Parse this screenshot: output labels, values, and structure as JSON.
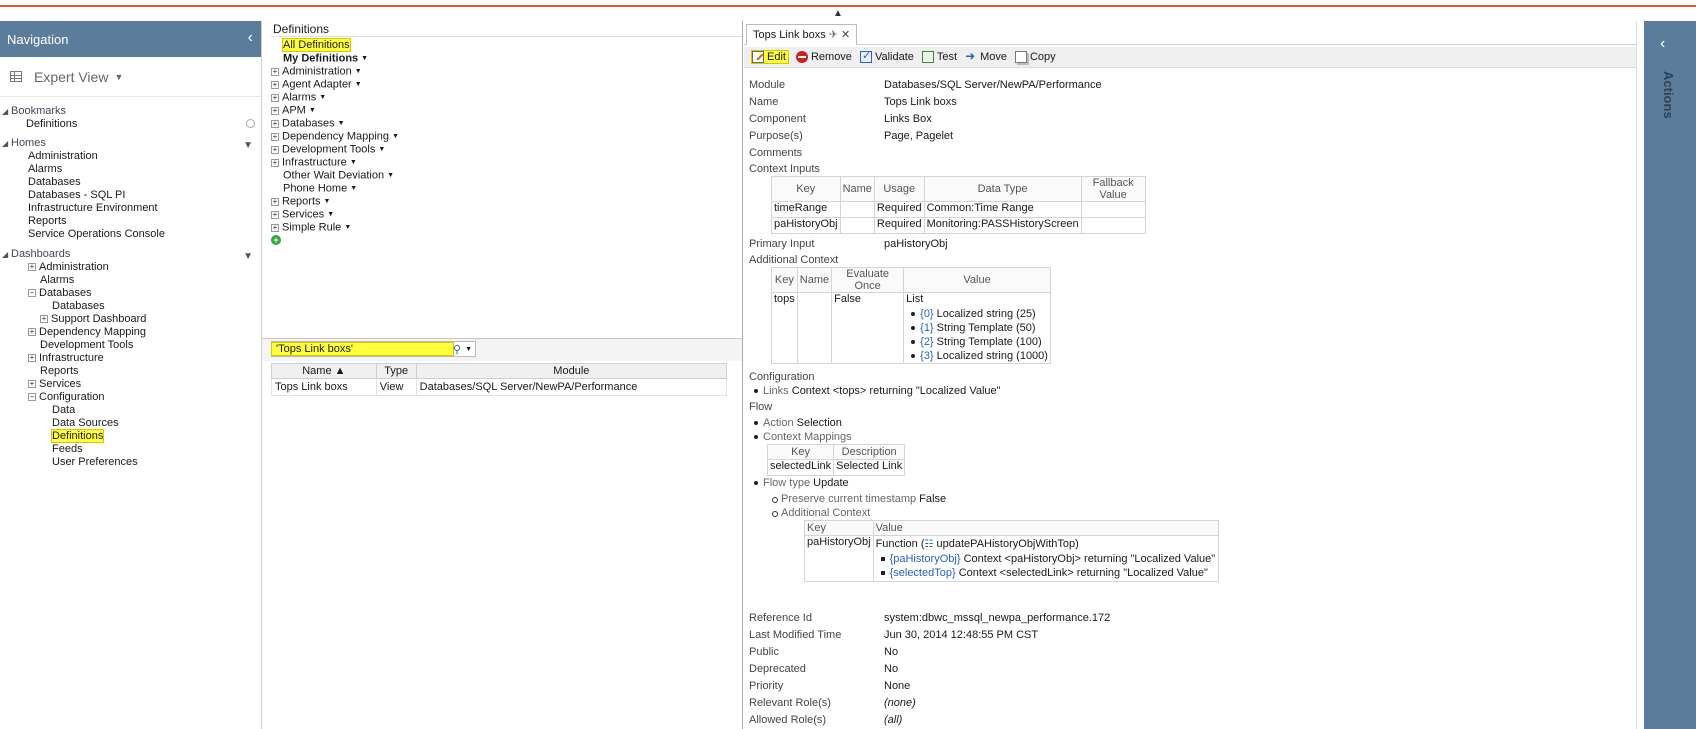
{
  "nav": {
    "title": "Navigation",
    "view": "Expert View",
    "bookmarks": {
      "title": "Bookmarks",
      "items": [
        "Definitions"
      ]
    },
    "homes": {
      "title": "Homes",
      "items": [
        "Administration",
        "Alarms",
        "Databases",
        "Databases - SQL PI",
        "Infrastructure Environment",
        "Reports",
        "Service Operations Console"
      ]
    },
    "dashboards": {
      "title": "Dashboards",
      "items": [
        {
          "label": "Administration",
          "level": 1,
          "exp": "+"
        },
        {
          "label": "Alarms",
          "level": 1,
          "exp": ""
        },
        {
          "label": "Databases",
          "level": 1,
          "exp": "-"
        },
        {
          "label": "Databases",
          "level": 2,
          "exp": ""
        },
        {
          "label": "Support Dashboard",
          "level": 2,
          "exp": "+"
        },
        {
          "label": "Dependency Mapping",
          "level": 1,
          "exp": "+"
        },
        {
          "label": "Development Tools",
          "level": 1,
          "exp": ""
        },
        {
          "label": "Infrastructure",
          "level": 1,
          "exp": "+"
        },
        {
          "label": "Reports",
          "level": 1,
          "exp": ""
        },
        {
          "label": "Services",
          "level": 1,
          "exp": "+"
        },
        {
          "label": "Configuration",
          "level": 1,
          "exp": "-"
        },
        {
          "label": "Data",
          "level": 2,
          "exp": ""
        },
        {
          "label": "Data Sources",
          "level": 2,
          "exp": ""
        },
        {
          "label": "Definitions",
          "level": 2,
          "exp": "",
          "highlight": true
        },
        {
          "label": "Feeds",
          "level": 2,
          "exp": ""
        },
        {
          "label": "User Preferences",
          "level": 2,
          "exp": ""
        }
      ]
    }
  },
  "definitions": {
    "title": "Definitions",
    "items": [
      {
        "label": "All Definitions",
        "exp": "",
        "dd": false,
        "highlight": true
      },
      {
        "label": "My Definitions",
        "exp": "",
        "dd": true,
        "bold": true
      },
      {
        "label": "Administration",
        "exp": "+",
        "dd": true
      },
      {
        "label": "Agent Adapter",
        "exp": "+",
        "dd": true
      },
      {
        "label": "Alarms",
        "exp": "+",
        "dd": true
      },
      {
        "label": "APM",
        "exp": "+",
        "dd": true
      },
      {
        "label": "Databases",
        "exp": "+",
        "dd": true
      },
      {
        "label": "Dependency Mapping",
        "exp": "+",
        "dd": true
      },
      {
        "label": "Development Tools",
        "exp": "+",
        "dd": true
      },
      {
        "label": "Infrastructure",
        "exp": "+",
        "dd": true
      },
      {
        "label": "Other Wait Deviation",
        "exp": "",
        "dd": true
      },
      {
        "label": "Phone Home",
        "exp": "",
        "dd": true
      },
      {
        "label": "Reports",
        "exp": "+",
        "dd": true
      },
      {
        "label": "Services",
        "exp": "+",
        "dd": true
      },
      {
        "label": "Simple Rule",
        "exp": "+",
        "dd": true
      }
    ]
  },
  "search": {
    "value": "'Tops Link boxs'",
    "columns": [
      "Name ▲",
      "Type",
      "Module"
    ],
    "rows": [
      [
        "Tops Link boxs",
        "View",
        "Databases/SQL Server/NewPA/Performance"
      ]
    ]
  },
  "detail": {
    "tab": "Tops Link boxs",
    "toolbar": [
      "Edit",
      "Remove",
      "Validate",
      "Test",
      "Move",
      "Copy"
    ],
    "fields": [
      {
        "label": "Module",
        "value": "Databases/SQL Server/NewPA/Performance"
      },
      {
        "label": "Name",
        "value": "Tops Link boxs"
      },
      {
        "label": "Component",
        "value": "Links Box"
      },
      {
        "label": "Purpose(s)",
        "value": "Page, Pagelet"
      },
      {
        "label": "Comments",
        "value": ""
      }
    ],
    "context_inputs": {
      "label": "Context Inputs",
      "columns": [
        "Key",
        "Name",
        "Usage",
        "Data Type",
        "Fallback Value"
      ],
      "rows": [
        [
          "timeRange",
          "",
          "Required",
          "Common:Time Range",
          ""
        ],
        [
          "paHistoryObj",
          "",
          "Required",
          "Monitoring:PASSHistoryScreen",
          ""
        ]
      ]
    },
    "primary_input": {
      "label": "Primary Input",
      "value": "paHistoryObj"
    },
    "additional_context": {
      "label": "Additional Context",
      "columns": [
        "Key",
        "Name",
        "Evaluate Once",
        "Value"
      ],
      "key": "tops",
      "name": "",
      "evaluate_once": "False",
      "value_title": "List",
      "list": [
        {
          "idx": "{0}",
          "text": "Localized string (25)"
        },
        {
          "idx": "{1}",
          "text": "String Template (50)"
        },
        {
          "idx": "{2}",
          "text": "String Template (100)"
        },
        {
          "idx": "{3}",
          "text": "Localized string (1000)"
        }
      ]
    },
    "configuration": {
      "label": "Configuration",
      "item_key": "Links",
      "item_text": "Context <tops> returning \"Localized Value\""
    },
    "flow": {
      "label": "Flow",
      "action_label": "Action",
      "action_value": "Selection",
      "mappings_label": "Context Mappings",
      "mappings_columns": [
        "Key",
        "Description"
      ],
      "mappings_row": [
        "selectedLink",
        "Selected Link"
      ],
      "flow_type_label": "Flow type",
      "flow_type_value": "Update",
      "preserve_label": "Preserve current timestamp",
      "preserve_value": "False",
      "add_ctx_label": "Additional Context",
      "add_ctx_columns": [
        "Key",
        "Value"
      ],
      "add_ctx_key": "paHistoryObj",
      "function_label": "Function (",
      "function_name": "updatePAHistoryObjWithTop)",
      "function_args": [
        {
          "idx": "{paHistoryObj}",
          "text": "Context <paHistoryObj> returning \"Localized Value\""
        },
        {
          "idx": "{selectedTop}",
          "text": "Context <selectedLink> returning \"Localized Value\""
        }
      ]
    },
    "meta": [
      {
        "label": "Reference Id",
        "value": "system:dbwc_mssql_newpa_performance.172",
        "ital": false
      },
      {
        "label": "Last Modified Time",
        "value": "Jun 30, 2014 12:48:55 PM CST",
        "ital": false
      },
      {
        "label": "Public",
        "value": "No",
        "ital": false
      },
      {
        "label": "Deprecated",
        "value": "No",
        "ital": false
      },
      {
        "label": "Priority",
        "value": "None",
        "ital": false
      },
      {
        "label": "Relevant Role(s)",
        "value": "(none)",
        "ital": true
      },
      {
        "label": "Allowed Role(s)",
        "value": "(all)",
        "ital": true
      }
    ]
  },
  "actions": {
    "title": "Actions"
  },
  "colors": {
    "header": "#5b7d9b",
    "highlight": "#ffff3d",
    "accent": "#e8542a"
  }
}
